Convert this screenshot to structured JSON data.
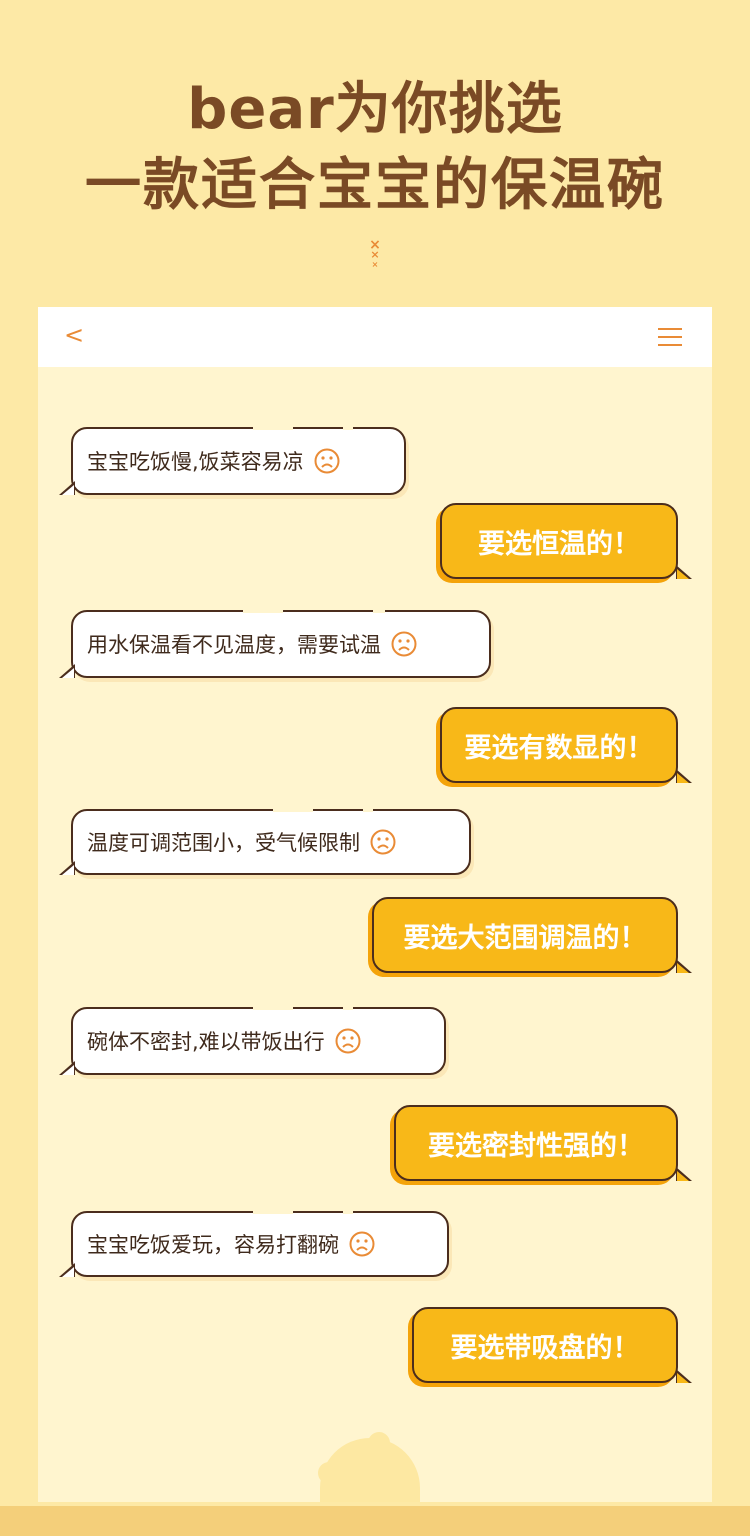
{
  "headline": {
    "line1": "bear为你挑选",
    "line2": "一款适合宝宝的保温碗"
  },
  "decoration_marks": [
    "×",
    "×",
    "×"
  ],
  "appbar": {
    "back_icon": "chevron-left-icon",
    "back_glyph": "<",
    "menu_icon": "hamburger-menu-icon"
  },
  "chat": {
    "messages": [
      {
        "side": "left",
        "text": "宝宝吃饭慢,饭菜容易凉",
        "icon": "sad-face-icon"
      },
      {
        "side": "right",
        "text": "要选恒温的！"
      },
      {
        "side": "left",
        "text": "用水保温看不见温度，需要试温",
        "icon": "sad-face-icon"
      },
      {
        "side": "right",
        "text": "要选有数显的！"
      },
      {
        "side": "left",
        "text": "温度可调范围小，受气候限制",
        "icon": "sad-face-icon"
      },
      {
        "side": "right",
        "text": "要选大范围调温的！"
      },
      {
        "side": "left",
        "text": "碗体不密封,难以带饭出行",
        "icon": "sad-face-icon"
      },
      {
        "side": "right",
        "text": "要选密封性强的！"
      },
      {
        "side": "left",
        "text": "宝宝吃饭爱玩，容易打翻碗",
        "icon": "sad-face-icon"
      },
      {
        "side": "right",
        "text": "要选带吸盘的！"
      }
    ]
  },
  "colors": {
    "background": "#fde9a6",
    "title": "#7a4a25",
    "accent": "#e98b36",
    "answer_bubble": "#f8b818",
    "outline": "#4b2d1d"
  }
}
